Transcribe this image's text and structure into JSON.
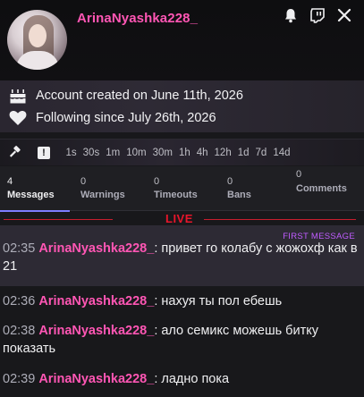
{
  "header": {
    "username": "ArinaNyashka228_",
    "icons": [
      "bell-icon",
      "twitch-icon",
      "close-icon"
    ]
  },
  "info": {
    "account_created": "Account created on June 11th, 2026",
    "following_since": "Following since July 26th, 2026"
  },
  "moderation": {
    "timeouts": [
      "1s",
      "30s",
      "1m",
      "10m",
      "30m",
      "1h",
      "4h",
      "12h",
      "1d",
      "7d",
      "14d"
    ]
  },
  "tabs": [
    {
      "count": "4",
      "label": "Messages",
      "active": true
    },
    {
      "count": "0",
      "label": "Warnings",
      "active": false
    },
    {
      "count": "0",
      "label": "Timeouts",
      "active": false
    },
    {
      "count": "0",
      "label": "Bans",
      "active": false
    },
    {
      "count": "0",
      "label": "Comments",
      "active": false
    }
  ],
  "live_label": "LIVE",
  "first_message_label": "FIRST MESSAGE",
  "messages": [
    {
      "time": "02:35",
      "user": "ArinaNyashka228_",
      "text": ": привет го колабу с жожохф как в 21",
      "first": true
    },
    {
      "time": "02:36",
      "user": "ArinaNyashka228_",
      "text": ": нахуя ты пол ебешь",
      "first": false
    },
    {
      "time": "02:38",
      "user": "ArinaNyashka228_",
      "text": ": ало семикс можешь битку показать",
      "first": false
    },
    {
      "time": "02:39",
      "user": "ArinaNyashka228_",
      "text": ": ладно пока",
      "first": false
    }
  ]
}
